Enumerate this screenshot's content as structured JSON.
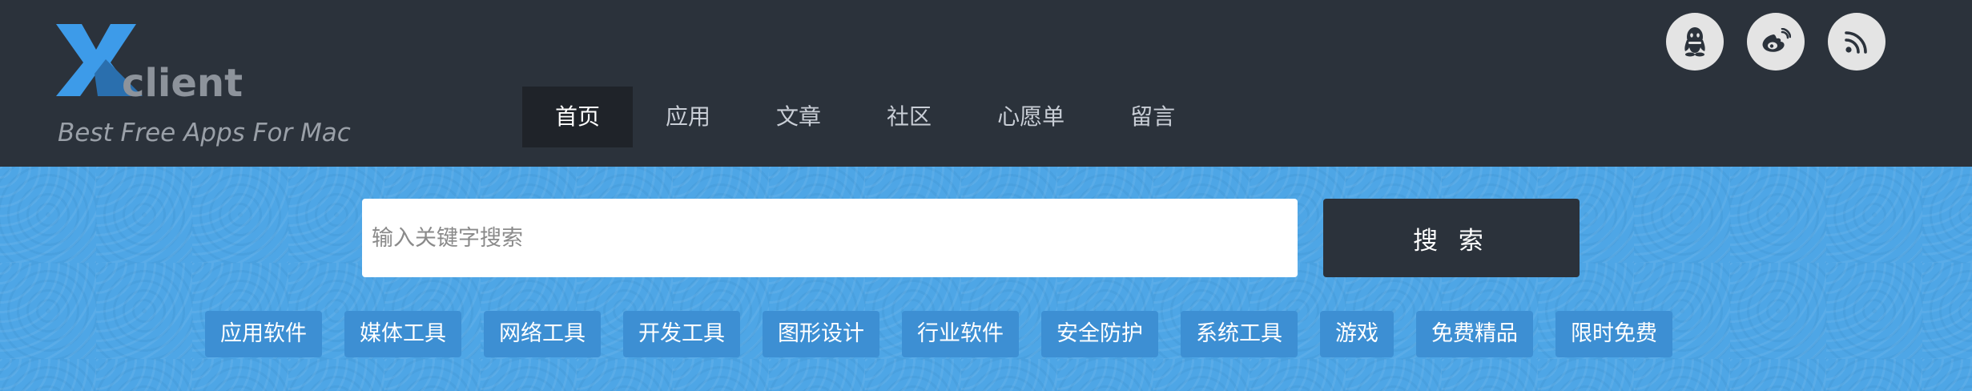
{
  "brand": {
    "logo_letter": "X",
    "logo_word": "client",
    "tagline": "Best Free Apps For Mac"
  },
  "nav": {
    "items": [
      {
        "label": "首页",
        "active": true
      },
      {
        "label": "应用"
      },
      {
        "label": "文章"
      },
      {
        "label": "社区"
      },
      {
        "label": "心愿单"
      },
      {
        "label": "留言"
      }
    ]
  },
  "social": [
    {
      "icon": "qq-icon"
    },
    {
      "icon": "weibo-icon"
    },
    {
      "icon": "rss-icon"
    }
  ],
  "search": {
    "placeholder": "输入关键字搜索",
    "button_label": "搜 索"
  },
  "categories": [
    "应用软件",
    "媒体工具",
    "网络工具",
    "开发工具",
    "图形设计",
    "行业软件",
    "安全防护",
    "系统工具",
    "游戏",
    "免费精品",
    "限时免费"
  ],
  "colors": {
    "header_bg": "#2b323b",
    "hero_bg": "#4ea6e6",
    "accent_blue": "#3d9be9",
    "tag_bg": "#3d8fd3"
  }
}
